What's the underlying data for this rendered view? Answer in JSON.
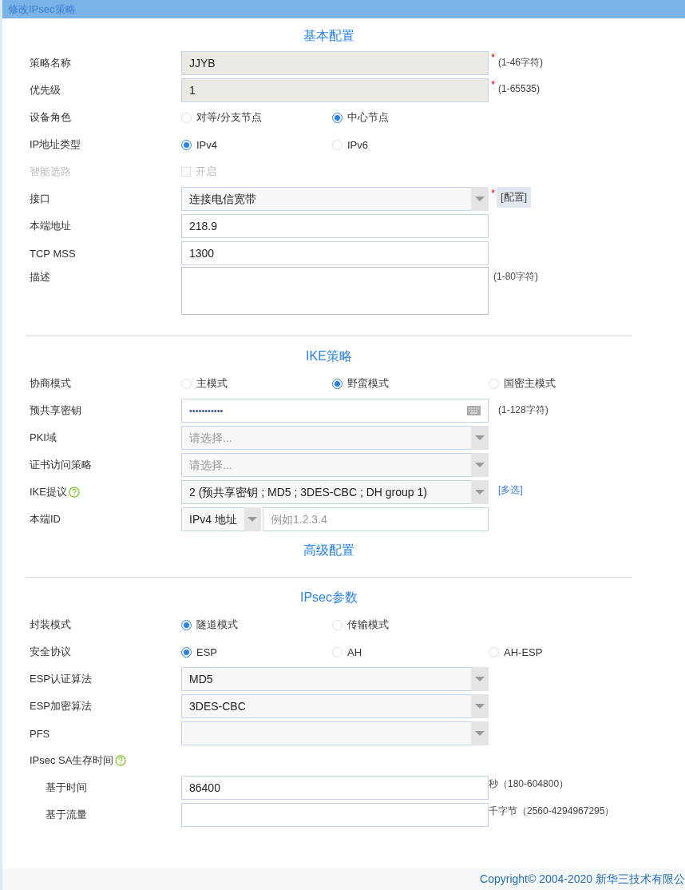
{
  "window": {
    "title": "修改IPsec策略"
  },
  "sections": [
    {
      "title": "基本配置",
      "rows": [
        {
          "label": "策略名称",
          "kind": "text",
          "value": "JJYB",
          "readonly": true,
          "required": "*",
          "hint": "(1-46字符)"
        },
        {
          "label": "优先级",
          "kind": "text",
          "value": "1",
          "readonly": true,
          "required": "*",
          "hint": "(1-65535)"
        },
        {
          "label": "设备角色",
          "kind": "radio",
          "options": [
            {
              "label": "对等/分支节点",
              "selected": false
            },
            {
              "label": "中心节点",
              "selected": true
            }
          ]
        },
        {
          "label": "IP地址类型",
          "kind": "radio",
          "options": [
            {
              "label": "IPv4",
              "selected": true
            },
            {
              "label": "IPv6",
              "selected": false
            }
          ]
        },
        {
          "label": "智能选路",
          "kind": "checkbox",
          "disabled": true,
          "checkbox": {
            "label": "开启",
            "checked": false
          }
        },
        {
          "label": "接口",
          "kind": "select",
          "value": "连接电信宽带",
          "required": "*",
          "action": "[配置]"
        },
        {
          "label": "本端地址",
          "kind": "text",
          "value": "218.9",
          "readonly": false
        },
        {
          "label": "TCP MSS",
          "kind": "text",
          "value": "1300",
          "readonly": false
        },
        {
          "label": "描述",
          "kind": "textarea",
          "hint": "(1-80字符)"
        }
      ]
    },
    {
      "title": "IKE策略",
      "divider": true,
      "rows": [
        {
          "label": "协商模式",
          "kind": "radio",
          "options": [
            {
              "label": "主模式",
              "selected": false
            },
            {
              "label": "野蛮模式",
              "selected": true
            },
            {
              "label": "国密主模式",
              "selected": false
            }
          ]
        },
        {
          "label": "预共享密钥",
          "kind": "password",
          "value": "•••••••••••",
          "hint": "(1-128字符)"
        },
        {
          "label": "PKI域",
          "kind": "select",
          "placeholder": "请选择..."
        },
        {
          "label": "证书访问策略",
          "kind": "select",
          "placeholder": "请选择..."
        },
        {
          "label": "IKE提议",
          "kind": "select",
          "help": true,
          "value": "2 (预共享密钥 ; MD5 ; 3DES-CBC ; DH group 1)",
          "link": "[多选]"
        },
        {
          "label": "本端ID",
          "kind": "combo",
          "value": "IPv4 地址",
          "placeholder": "例如1.2.3.4"
        }
      ]
    },
    {
      "title": "高级配置"
    },
    {
      "title": "IPsec参数",
      "divider": true,
      "rows": [
        {
          "label": "封装模式",
          "kind": "radio",
          "options": [
            {
              "label": "隧道模式",
              "selected": true
            },
            {
              "label": "传输模式",
              "selected": false
            }
          ]
        },
        {
          "label": "安全协议",
          "kind": "radio",
          "options": [
            {
              "label": "ESP",
              "selected": true
            },
            {
              "label": "AH",
              "selected": false
            },
            {
              "label": "AH-ESP",
              "selected": false
            }
          ]
        },
        {
          "label": "ESP认证算法",
          "kind": "select",
          "value": "MD5"
        },
        {
          "label": "ESP加密算法",
          "kind": "select",
          "value": "3DES-CBC"
        },
        {
          "label": "PFS",
          "kind": "select"
        },
        {
          "label": "IPsec SA生存时间",
          "kind": "group",
          "help": true,
          "children": [
            {
              "label": "基于时间",
              "kind": "text",
              "value": "86400",
              "readonly": false,
              "unit": "秒（180-604800）"
            },
            {
              "label": "基于流量",
              "kind": "text",
              "readonly": false,
              "unit": "千字节（2560-4294967295）"
            }
          ]
        }
      ]
    }
  ],
  "footer": {
    "copyright": "Copyright© 2004-2020 新华三技术有限公"
  }
}
